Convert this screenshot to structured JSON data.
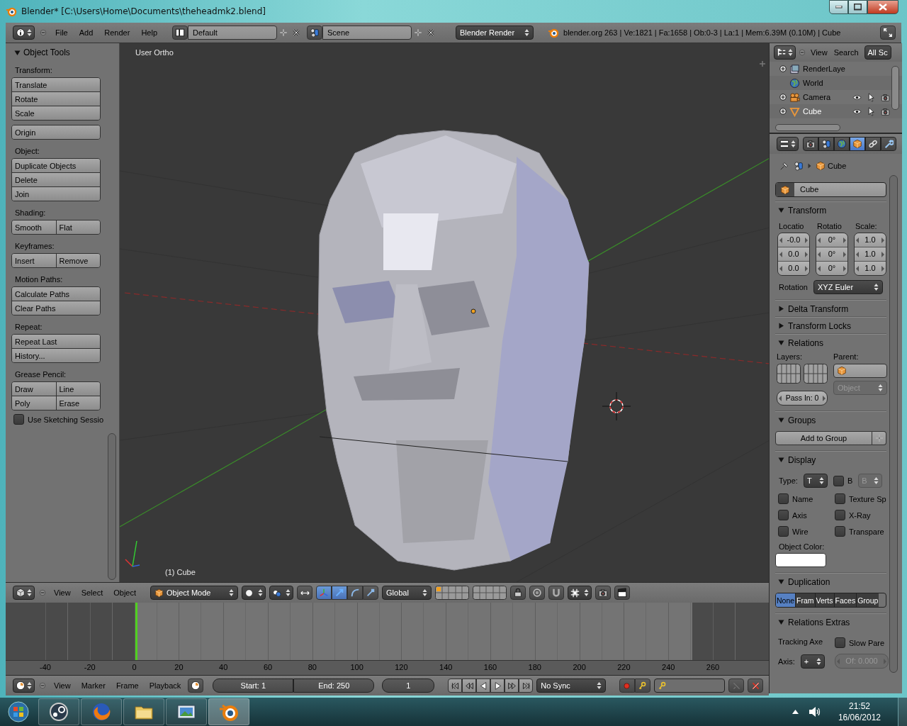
{
  "window": {
    "title": "Blender* [C:\\Users\\Home\\Documents\\theheadmk2.blend]"
  },
  "info_header": {
    "menus": [
      "File",
      "Add",
      "Render",
      "Help"
    ],
    "screen_layout": "Default",
    "scene": "Scene",
    "render_engine": "Blender Render",
    "stats": "blender.org 263 | Ve:1821 | Fa:1658 | Ob:0-3 | La:1 | Mem:6.39M (0.10M) | Cube"
  },
  "tool_panel": {
    "title": "Object Tools",
    "expanded": true,
    "sections": [
      {
        "label": "Transform:",
        "rows": [
          [
            "Translate"
          ],
          [
            "Rotate"
          ],
          [
            "Scale"
          ]
        ]
      },
      {
        "rows": [
          [
            "Origin"
          ]
        ]
      },
      {
        "label": "Object:",
        "rows": [
          [
            "Duplicate Objects"
          ],
          [
            "Delete"
          ],
          [
            "Join"
          ]
        ]
      },
      {
        "label": "Shading:",
        "rows": [
          [
            "Smooth",
            "Flat"
          ]
        ]
      },
      {
        "label": "Keyframes:",
        "rows": [
          [
            "Insert",
            "Remove"
          ]
        ]
      },
      {
        "label": "Motion Paths:",
        "rows": [
          [
            "Calculate Paths"
          ],
          [
            "Clear Paths"
          ]
        ]
      },
      {
        "label": "Repeat:",
        "rows": [
          [
            "Repeat Last"
          ],
          [
            "History..."
          ]
        ]
      },
      {
        "label": "Grease Pencil:",
        "rows": [
          [
            "Draw",
            "Line"
          ],
          [
            "Poly",
            "Erase"
          ]
        ]
      }
    ],
    "option": {
      "label": "Use Sketching Sessio",
      "checked": false
    }
  },
  "viewport": {
    "view_label": "User Ortho",
    "object_label": "(1) Cube"
  },
  "viewport_header": {
    "menus": [
      "View",
      "Select",
      "Object"
    ],
    "mode": "Object Mode",
    "orientation": "Global"
  },
  "timeline": {
    "ticks": [
      "-40",
      "-20",
      "0",
      "20",
      "40",
      "60",
      "80",
      "100",
      "120",
      "140",
      "160",
      "180",
      "200",
      "220",
      "240",
      "260"
    ]
  },
  "timeline_header": {
    "menus": [
      "View",
      "Marker",
      "Frame",
      "Playback"
    ],
    "start": "Start: 1",
    "end": "End: 250",
    "frame": "1",
    "sync": "No Sync"
  },
  "outliner": {
    "menus": [
      "View",
      "Search"
    ],
    "filter": "All Sc",
    "items": [
      {
        "name": "RenderLaye",
        "kind": "renderlayers",
        "expanded": false,
        "selected": false
      },
      {
        "name": "World",
        "kind": "world",
        "selected": false
      },
      {
        "name": "Camera",
        "kind": "camera",
        "expanded": false,
        "selected": false
      },
      {
        "name": "Cube",
        "kind": "mesh",
        "expanded": false,
        "selected": true
      }
    ]
  },
  "properties": {
    "tabs": [
      {
        "kind": "render",
        "selected": false
      },
      {
        "kind": "scene",
        "selected": false
      },
      {
        "kind": "world",
        "selected": false
      },
      {
        "kind": "object",
        "selected": true
      },
      {
        "kind": "constraints",
        "selected": false
      },
      {
        "kind": "modifiers",
        "selected": false
      }
    ],
    "breadcrumb": "Cube",
    "object_name": "Cube",
    "panels": [
      {
        "title": "Transform",
        "kind": "transform",
        "expanded": true,
        "columns": [
          {
            "label": "Locatio",
            "values": [
              "-0.0",
              "0.0",
              "0.0"
            ]
          },
          {
            "label": "Rotatio",
            "values": [
              "0°",
              "0°",
              "0°"
            ]
          },
          {
            "label": "Scale:",
            "values": [
              "1.0",
              "1.0",
              "1.0"
            ]
          }
        ],
        "rotation_label": "Rotation",
        "rotation_mode": "XYZ Euler"
      },
      {
        "title": "Delta Transform",
        "expanded": false
      },
      {
        "title": "Transform Locks",
        "expanded": false
      },
      {
        "title": "Relations",
        "kind": "relations",
        "expanded": true,
        "layers_label": "Layers:",
        "parent_label": "Parent:",
        "parent_type": "Object",
        "pass_index": "Pass In: 0"
      },
      {
        "title": "Groups",
        "kind": "groups",
        "expanded": true,
        "button": "Add to Group"
      },
      {
        "title": "Display",
        "kind": "display",
        "expanded": true,
        "type_label": "Type:",
        "type": "T",
        "bounds": {
          "label": "B",
          "checked": false
        },
        "bounds_type": "B",
        "options": [
          {
            "label": "Name",
            "checked": false
          },
          {
            "label": "Texture Sp",
            "checked": false
          },
          {
            "label": "Axis",
            "checked": false
          },
          {
            "label": "X-Ray",
            "checked": false
          },
          {
            "label": "Wire",
            "checked": false
          },
          {
            "label": "Transpare",
            "checked": false
          }
        ],
        "color_label": "Object Color:",
        "color": "#ffffff"
      },
      {
        "title": "Duplication",
        "kind": "duplication",
        "expanded": true,
        "options": [
          {
            "label": "None",
            "selected": true
          },
          {
            "label": "Fram",
            "selected": false
          },
          {
            "label": "Verts",
            "selected": false
          },
          {
            "label": "Faces",
            "selected": false
          },
          {
            "label": "Group",
            "selected": false
          }
        ]
      },
      {
        "title": "Relations Extras",
        "kind": "relations_extras",
        "expanded": true,
        "tracking_label": "Tracking Axe",
        "slow_parent": {
          "label": "Slow Pare",
          "checked": false
        },
        "axis_label": "Axis:",
        "axis": "+",
        "offset": "Of: 0.000"
      }
    ]
  },
  "taskbar": {
    "apps": [
      {
        "kind": "steam",
        "selected": false
      },
      {
        "kind": "firefox",
        "selected": false
      },
      {
        "kind": "folder",
        "selected": false
      },
      {
        "kind": "photos",
        "selected": false
      },
      {
        "kind": "blender",
        "selected": true
      }
    ],
    "time": "21:52",
    "date": "16/06/2012"
  }
}
